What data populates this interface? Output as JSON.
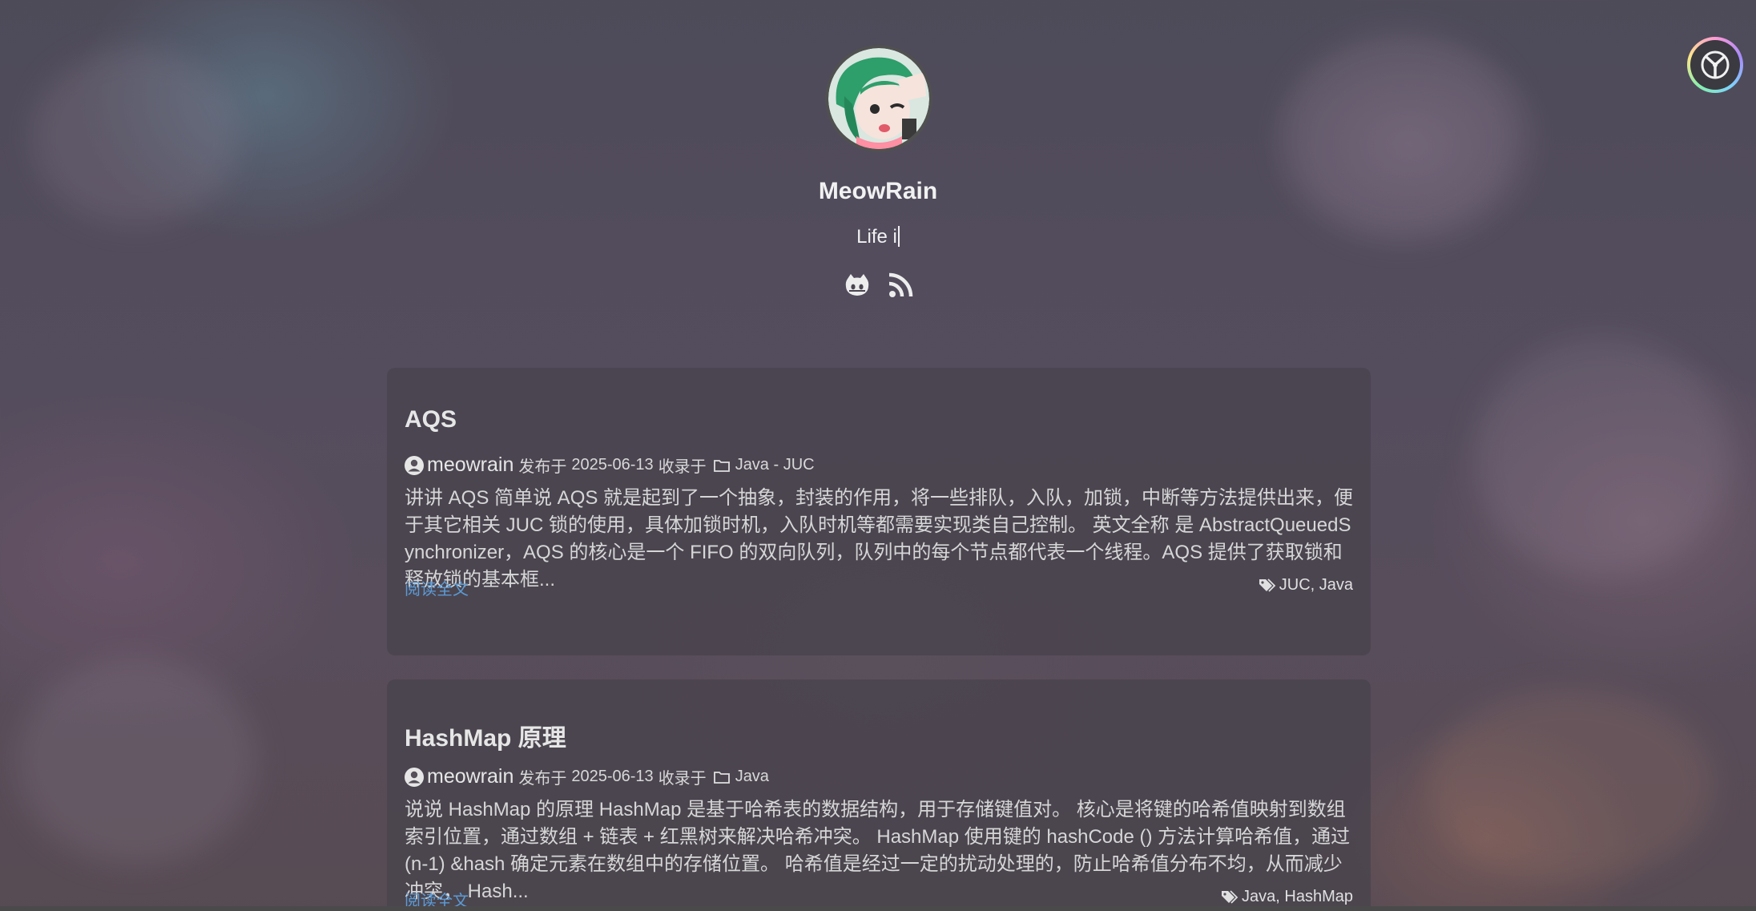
{
  "site": {
    "name": "MeowRain",
    "subtitle": "Life i"
  },
  "social": [
    "github-icon",
    "rss-icon"
  ],
  "posts": [
    {
      "title": "AQS",
      "author": "meowrain",
      "published_prefix": "发布于",
      "date": "2025-06-13",
      "category_prefix": "收录于",
      "category": "Java - JUC",
      "excerpt": "讲讲 AQS 简单说 AQS 就是起到了一个抽象，封装的作用，将一些排队，入队，加锁，中断等方法提供出来，便于其它相关 JUC 锁的使用，具体加锁时机，入队时机等都需要实现类自己控制。 英文全称 是 AbstractQueuedSynchronizer，AQS 的核心是一个 FIFO 的双向队列，队列中的每个节点都代表一个线程。AQS 提供了获取锁和释放锁的基本框...",
      "read_more": "阅读全文",
      "tags": "JUC, Java"
    },
    {
      "title": "HashMap 原理",
      "author": "meowrain",
      "published_prefix": "发布于",
      "date": "2025-06-13",
      "category_prefix": "收录于",
      "category": "Java",
      "excerpt": "说说 HashMap 的原理 HashMap 是基于哈希表的数据结构，用于存储键值对。 核心是将键的哈希值映射到数组索引位置，通过数组 + 链表 + 红黑树来解决哈希冲突。 HashMap 使用键的 hashCode () 方法计算哈希值，通过 (n-1) &hash 确定元素在数组中的存储位置。 哈希值是经过一定的扰动处理的，防止哈希值分布不均，从而减少冲突， Hash...",
      "read_more": "阅读全文",
      "tags": "Java, HashMap"
    }
  ],
  "colors": {
    "link": "#5b9bd5",
    "card_bg": "rgba(70,66,76,0.72)",
    "text": "#e6e6e6"
  }
}
